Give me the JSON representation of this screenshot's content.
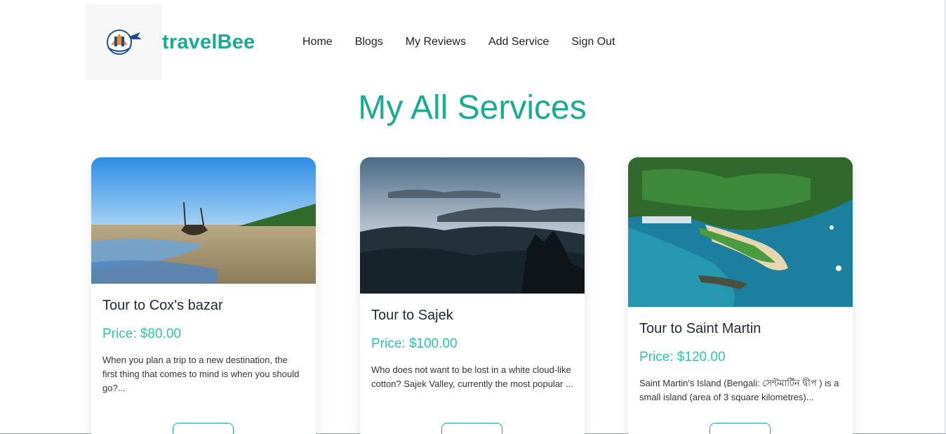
{
  "brand": {
    "name": "travelBee",
    "logo_icon": "travel-logo-icon"
  },
  "nav": {
    "items": [
      {
        "label": "Home"
      },
      {
        "label": "Blogs"
      },
      {
        "label": "My Reviews"
      },
      {
        "label": "Add Service"
      },
      {
        "label": "Sign Out"
      }
    ]
  },
  "page": {
    "title": "My All Services"
  },
  "services": [
    {
      "title": "Tour to Cox's bazar",
      "price": "Price: $80.00",
      "description": "When you plan a trip to a new destination, the first thing that comes to mind is when you should go?...",
      "image_icon": "beach-boat-image"
    },
    {
      "title": "Tour to Sajek",
      "price": "Price: $100.00",
      "description": "Who does not want to be lost in a white cloud-like cotton? Sajek Valley, currently the most popular ...",
      "image_icon": "misty-hills-image"
    },
    {
      "title": "Tour to Saint Martin",
      "price": "Price: $120.00",
      "description": "Saint Martin's Island (Bengali: সেন্টমার্টিন দ্বীপ ) is a small island (area of 3 square kilometres)...",
      "image_icon": "island-aerial-image"
    }
  ],
  "colors": {
    "accent": "#1aab94",
    "price": "#2ec4a5"
  }
}
